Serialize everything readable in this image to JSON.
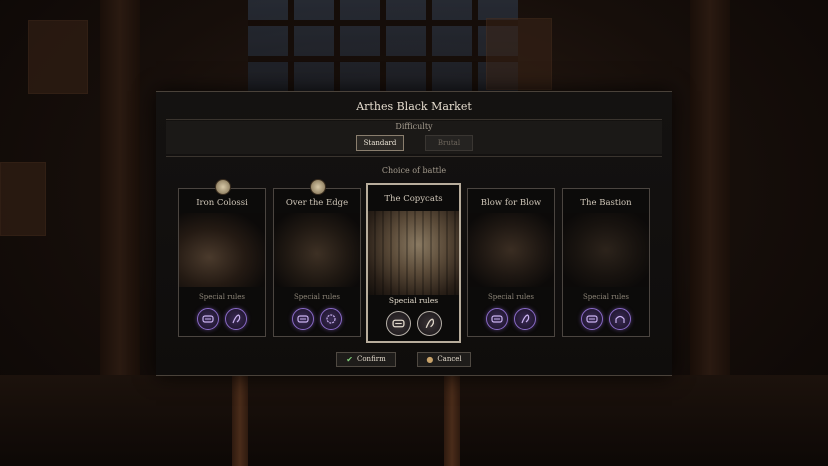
{
  "dialog": {
    "title": "Arthes Black Market",
    "difficulty_label": "Difficulty",
    "difficulty_options": [
      {
        "label": "Standard",
        "selected": true
      },
      {
        "label": "Brutal",
        "selected": false
      }
    ],
    "choice_label": "Choice of battle"
  },
  "battles": [
    {
      "name": "Iron Colossi",
      "special_rules_label": "Special rules",
      "icons": [
        "cuff-rule-icon",
        "hook-rule-icon"
      ],
      "skull_marker": true,
      "selected": false
    },
    {
      "name": "Over the Edge",
      "special_rules_label": "Special rules",
      "icons": [
        "cuff-rule-icon",
        "ring-rule-icon"
      ],
      "skull_marker": true,
      "selected": false
    },
    {
      "name": "The Copycats",
      "special_rules_label": "Special rules",
      "icons": [
        "cuff-rule-icon",
        "hook-rule-icon"
      ],
      "skull_marker": false,
      "selected": true
    },
    {
      "name": "Blow for Blow",
      "special_rules_label": "Special rules",
      "icons": [
        "cuff-rule-icon",
        "hook-rule-icon"
      ],
      "skull_marker": false,
      "selected": false
    },
    {
      "name": "The Bastion",
      "special_rules_label": "Special rules",
      "icons": [
        "cuff-rule-icon",
        "arch-rule-icon"
      ],
      "skull_marker": false,
      "selected": false
    }
  ],
  "actions": {
    "confirm_label": "Confirm",
    "cancel_label": "Cancel"
  },
  "colors": {
    "rule_icon_glow": "#8b6bc9",
    "confirm_check": "#7fd07a",
    "cancel_icon": "#c9a36a"
  }
}
